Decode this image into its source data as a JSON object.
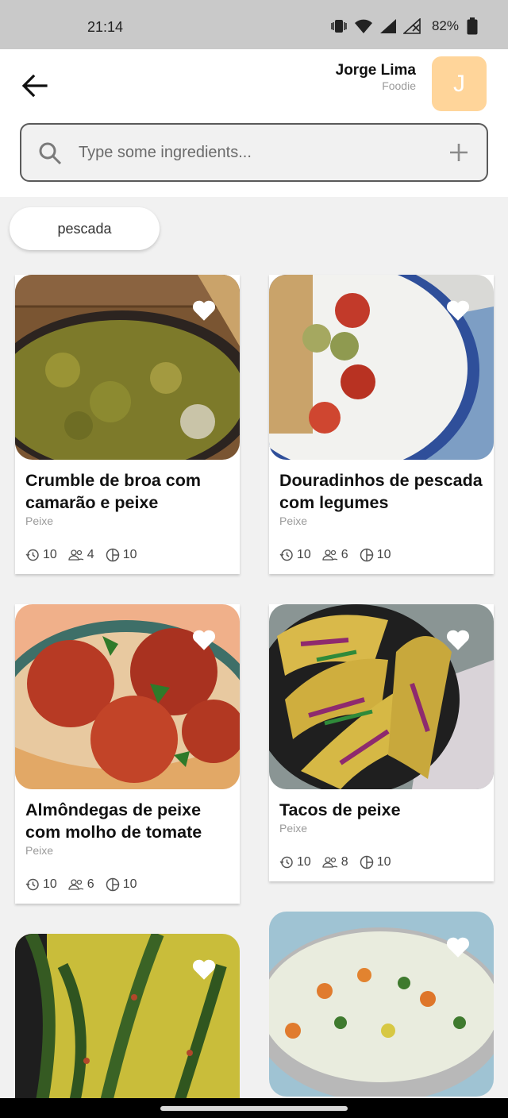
{
  "status_bar": {
    "time": "21:14",
    "battery": "82%"
  },
  "header": {
    "user_name": "Jorge Lima",
    "user_role": "Foodie",
    "avatar_initial": "J",
    "back_icon": "arrow-left-icon"
  },
  "search": {
    "placeholder": "Type some ingredients...",
    "value": ""
  },
  "filters": {
    "chips": [
      "pescada"
    ]
  },
  "recipes": [
    {
      "title": "Crumble de broa com camarão e peixe",
      "category": "Peixe",
      "time": "10",
      "servings": "4",
      "difficulty": "10"
    },
    {
      "title": "Douradinhos de pescada com legumes",
      "category": "Peixe",
      "time": "10",
      "servings": "6",
      "difficulty": "10"
    },
    {
      "title": "Almôndegas de peixe com molho de tomate",
      "category": "Peixe",
      "time": "10",
      "servings": "6",
      "difficulty": "10"
    },
    {
      "title": "Tacos de peixe",
      "category": "Peixe",
      "time": "10",
      "servings": "8",
      "difficulty": "10"
    }
  ],
  "colors": {
    "avatar_bg": "#ffd59a",
    "status_bar": "#c9c9c9",
    "background": "#f1f1f1"
  }
}
